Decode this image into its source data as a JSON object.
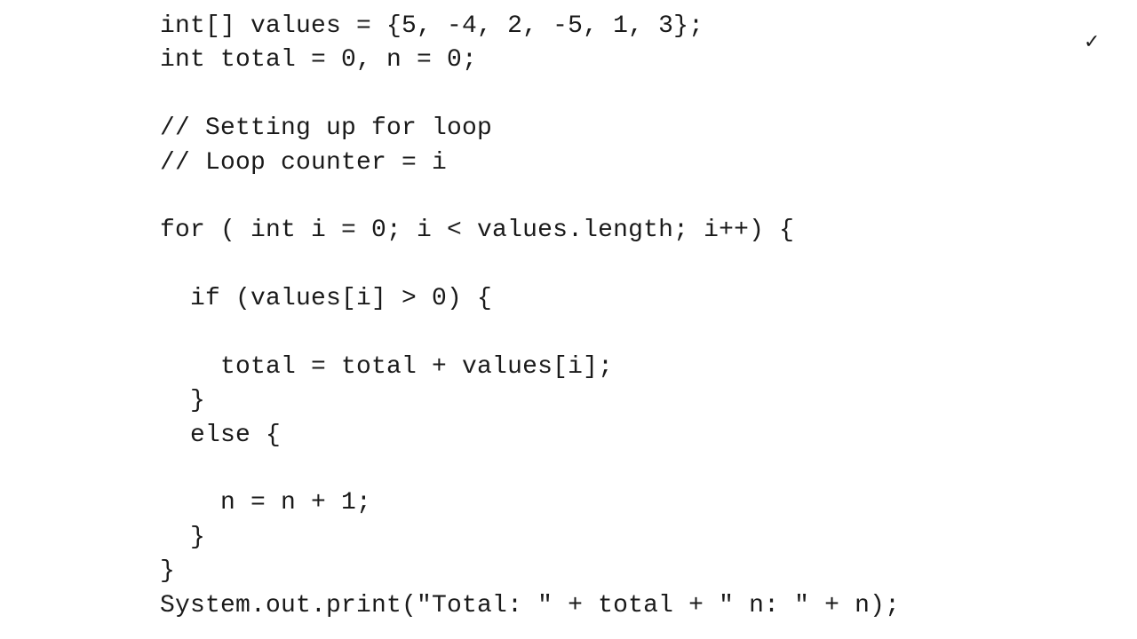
{
  "status": {
    "check_mark": "✓"
  },
  "code": {
    "lines": [
      "int[] values = {5, -4, 2, -5, 1, 3};",
      "int total = 0, n = 0;",
      "",
      "// Setting up for loop",
      "// Loop counter = i",
      "",
      "for ( int i = 0; i < values.length; i++) {",
      "",
      "  if (values[i] > 0) {",
      "",
      "    total = total + values[i];",
      "  }",
      "  else {",
      "",
      "    n = n + 1;",
      "  }",
      "}",
      "System.out.print(\"Total: \" + total + \" n: \" + n);"
    ]
  }
}
